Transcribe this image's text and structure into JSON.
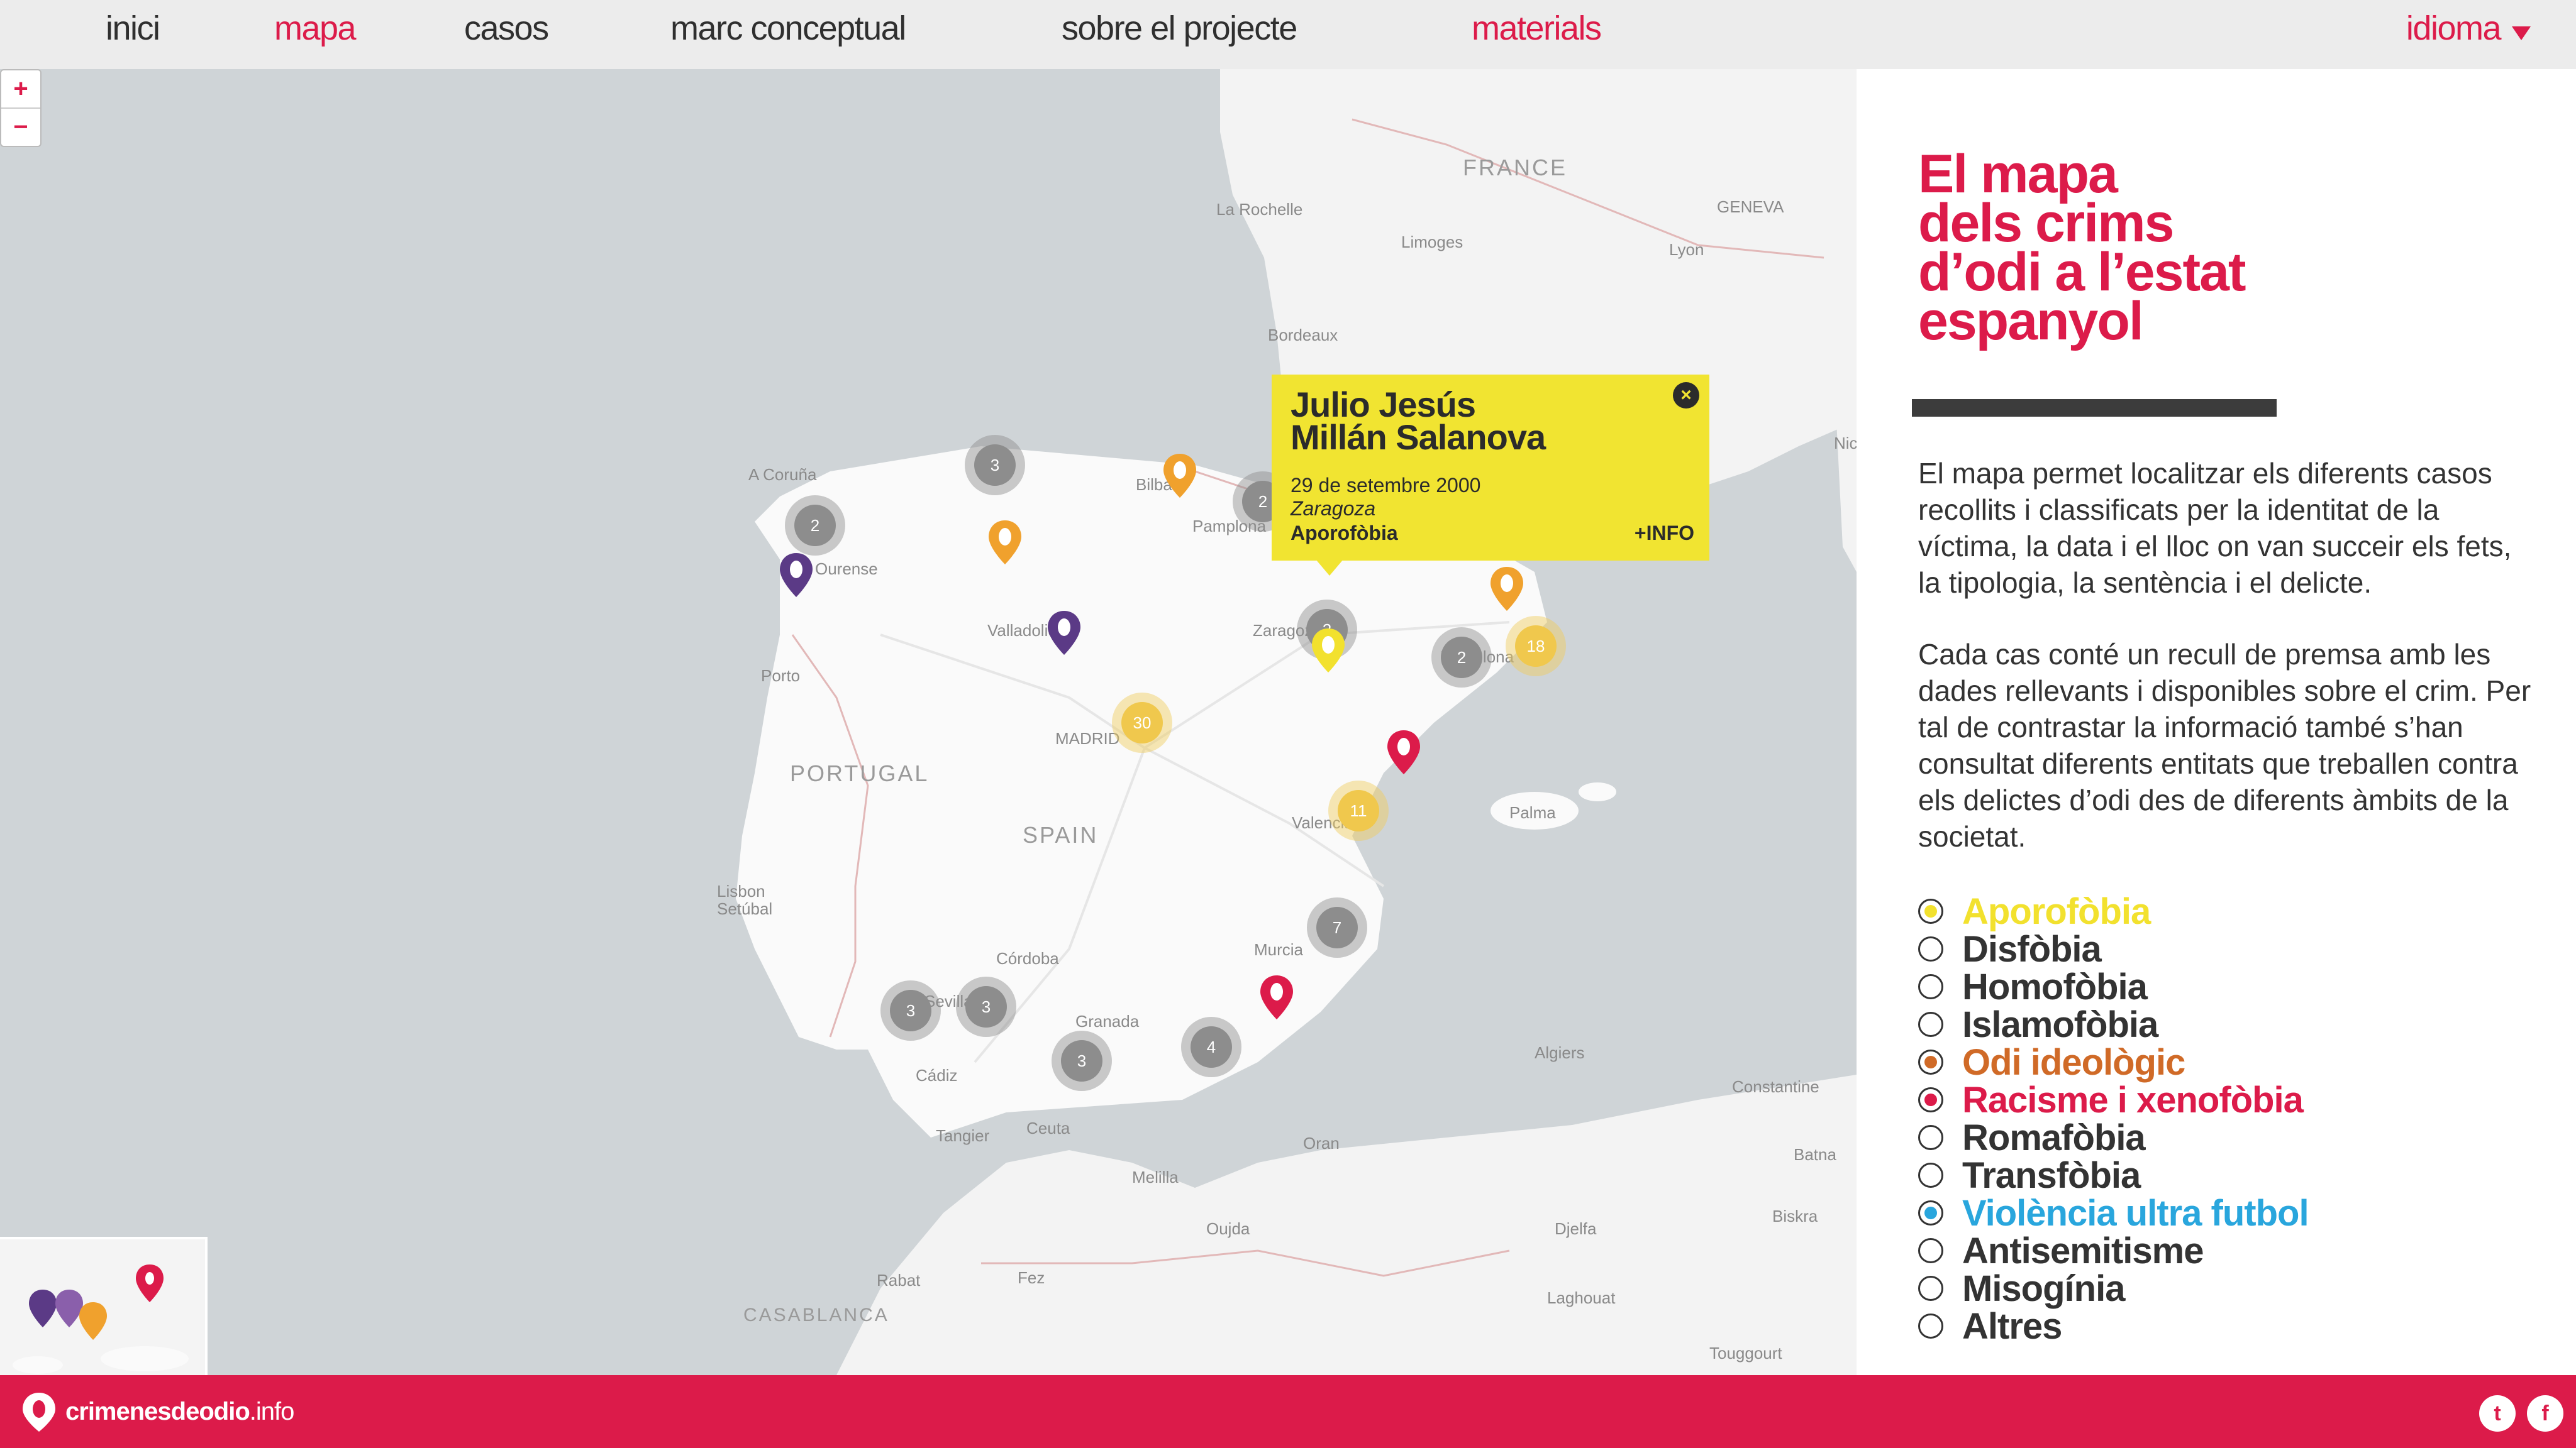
{
  "nav": {
    "items": [
      {
        "label": "inici",
        "active": false
      },
      {
        "label": "mapa",
        "active": true
      },
      {
        "label": "casos",
        "active": false
      },
      {
        "label": "marc conceptual",
        "active": false
      },
      {
        "label": "sobre el projecte",
        "active": false
      },
      {
        "label": "materials",
        "active": true
      }
    ],
    "language_label": "idioma",
    "language_icon": "caret-down-icon"
  },
  "map": {
    "zoom_in": "+",
    "zoom_out": "−",
    "places": {
      "france": "FRANCE",
      "portugal": "PORTUGAL",
      "spain": "SPAIN",
      "madrid": "MADRID",
      "la_rochelle": "La Rochelle",
      "limoges": "Limoges",
      "geneva": "GENEVA",
      "lyon": "Lyon",
      "bordeaux": "Bordeaux",
      "a_coruna": "A Coruña",
      "ourense": "Ourense",
      "valladolid": "Valladolid",
      "porto": "Porto",
      "bilbao": "Bilbao",
      "pamplona": "Pamplona",
      "zaragoza": "Zaragoza",
      "barcelona": "Barcelona",
      "valencia": "Valencia",
      "palma": "Palma",
      "lisbon": "Lisbon\nSetúbal",
      "cordoba": "Córdoba",
      "sevilla": "Sevilla",
      "granada": "Granada",
      "murcia": "Murcia",
      "cadiz": "Cádiz",
      "tangier": "Tangier",
      "ceuta": "Ceuta",
      "rabat": "Rabat",
      "fez": "Fez",
      "oujda": "Oujda",
      "melilla": "Melilla",
      "oran": "Oran",
      "algiers": "Algiers",
      "djelfa": "Djelfa",
      "batna": "Batna",
      "biskra": "Biskra",
      "constantine": "Constantine",
      "laghouat": "Laghouat",
      "touggourt": "Touggourt",
      "casablanca": "CASABLANCA",
      "nice": "Nic"
    },
    "clusters": {
      "c1": "3",
      "c2": "2",
      "c3": "2",
      "c4": "2",
      "c5": "30",
      "c6": "2",
      "c7": "18",
      "c8": "11",
      "c9": "7",
      "c10": "3",
      "c11": "3",
      "c12": "3",
      "c13": "4"
    },
    "colors": {
      "aporofobia": "#f2e12e",
      "odi_ideologic": "#f0a12d",
      "racisme": "#dc1b4a",
      "purple": "#5b3a86",
      "ultra_futbol": "#29a6dd"
    }
  },
  "popup": {
    "name": "Julio Jesús\nMillán Salanova",
    "date": "29 de setembre 2000",
    "city": "Zaragoza",
    "type": "Aporofòbia",
    "more": "+INFO",
    "close_icon": "close-icon"
  },
  "panel": {
    "title": "El mapa\ndels crims\nd’odi a l’estat\nespanyol",
    "paragraph1": "El mapa permet localitzar els diferents casos recollits i classificats per la identitat de la víctima, la data i el lloc on van succeir els fets, la tipologia, la sentència i el delicte.",
    "paragraph2": "Cada cas conté un recull de premsa amb les dades rellevants i disponibles sobre el crim. Per tal de contrastar la informació també s’han consultat diferents entitats que treballen contra els delictes d’odi des de diferents àmbits de la societat.",
    "filters": [
      {
        "label": "Aporofòbia",
        "color": "#f2e12e",
        "selected": true
      },
      {
        "label": "Disfòbia",
        "color": "#333333",
        "selected": false
      },
      {
        "label": "Homofòbia",
        "color": "#333333",
        "selected": false
      },
      {
        "label": "Islamofòbia",
        "color": "#333333",
        "selected": false
      },
      {
        "label": "Odi ideològic",
        "color": "#d06a27",
        "selected": true
      },
      {
        "label": "Racisme i xenofòbia",
        "color": "#dc1b4a",
        "selected": true
      },
      {
        "label": "Romafòbia",
        "color": "#333333",
        "selected": false
      },
      {
        "label": "Transfòbia",
        "color": "#333333",
        "selected": false
      },
      {
        "label": "Violència ultra futbol",
        "color": "#29a6dd",
        "selected": true
      },
      {
        "label": "Antisemitisme",
        "color": "#333333",
        "selected": false
      },
      {
        "label": "Misogínia",
        "color": "#333333",
        "selected": false
      },
      {
        "label": "Altres",
        "color": "#333333",
        "selected": false
      }
    ]
  },
  "footer": {
    "logo_main": "crimenesdeodio",
    "logo_suffix": ".info",
    "logo_icon": "map-pin-logo-icon",
    "twitter_icon": "twitter-icon",
    "facebook_icon": "facebook-icon",
    "twitter_glyph": "t",
    "facebook_glyph": "f"
  }
}
